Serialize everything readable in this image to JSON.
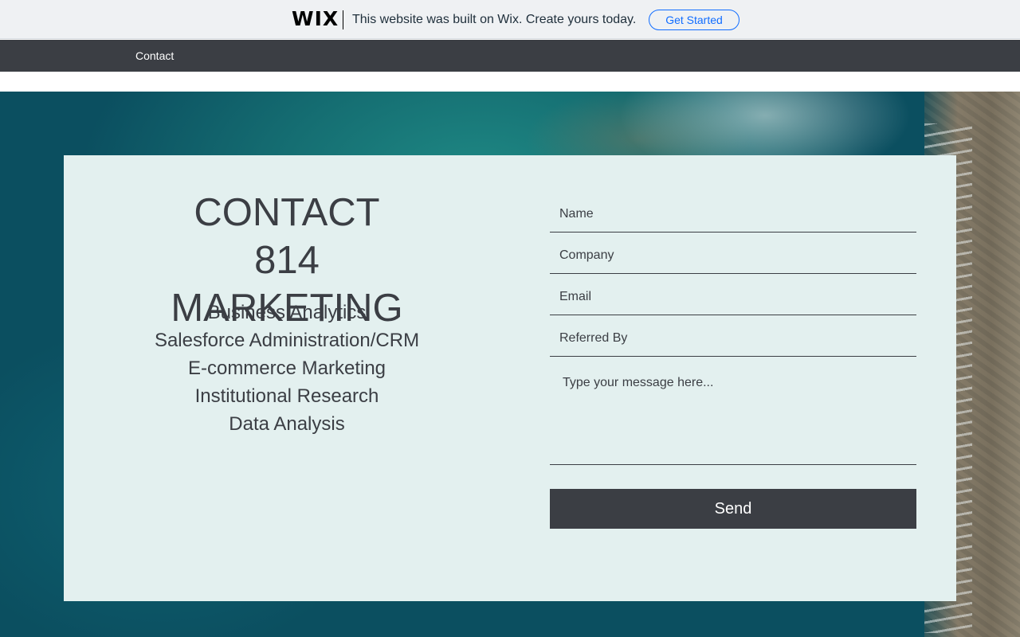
{
  "wix_banner": {
    "logo": "WIX",
    "message": "This website was built on Wix. Create yours today.",
    "cta": "Get Started"
  },
  "nav": {
    "items": [
      {
        "label": "Contact"
      }
    ]
  },
  "contact": {
    "title_line1": "CONTACT",
    "title_line2": "814 MARKETING",
    "services": [
      "Business Analytics",
      "Salesforce Administration/CRM",
      "E-commerce Marketing",
      "Institutional Research",
      "Data Analysis"
    ]
  },
  "form": {
    "name_placeholder": "Name",
    "company_placeholder": "Company",
    "email_placeholder": "Email",
    "referred_placeholder": "Referred By",
    "message_placeholder": "Type your message here...",
    "send_label": "Send"
  },
  "colors": {
    "banner_bg": "#eff1f3",
    "nav_bg": "#3b3e44",
    "card_bg": "#e3f0ef",
    "wix_blue": "#116dff",
    "text_dark": "#3b3e44"
  }
}
